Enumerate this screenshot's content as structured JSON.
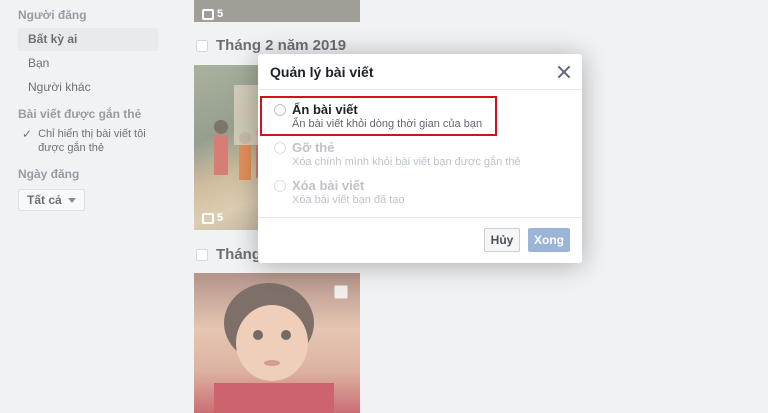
{
  "filters": {
    "poster_title": "Người đăng",
    "poster_options": [
      "Bất kỳ ai",
      "Bạn",
      "Người khác"
    ],
    "tagged_title": "Bài viết được gắn thẻ",
    "tagged_checkbox": "Chỉ hiển thị bài viết tôi được gắn thẻ",
    "date_title": "Ngày đăng",
    "date_dropdown": "Tất cả"
  },
  "timeline": {
    "month_1": "Tháng 2 năm 2019",
    "month_2": "Tháng",
    "photo_count_top": "5",
    "photo_count_mid": "5"
  },
  "dialog": {
    "title": "Quản lý bài viết",
    "options": [
      {
        "label": "Ẩn bài viết",
        "desc": "Ẩn bài viết khỏi dòng thời gian của bạn"
      },
      {
        "label": "Gỡ thẻ",
        "desc": "Xóa chính mình khỏi bài viết bạn được gắn thẻ"
      },
      {
        "label": "Xóa bài viết",
        "desc": "Xóa bài viết bạn đã tạo"
      }
    ],
    "cancel_label": "Hủy",
    "done_label": "Xong"
  },
  "colors": {
    "highlight": "#d0121b",
    "done_button": "#9cb4d8"
  }
}
